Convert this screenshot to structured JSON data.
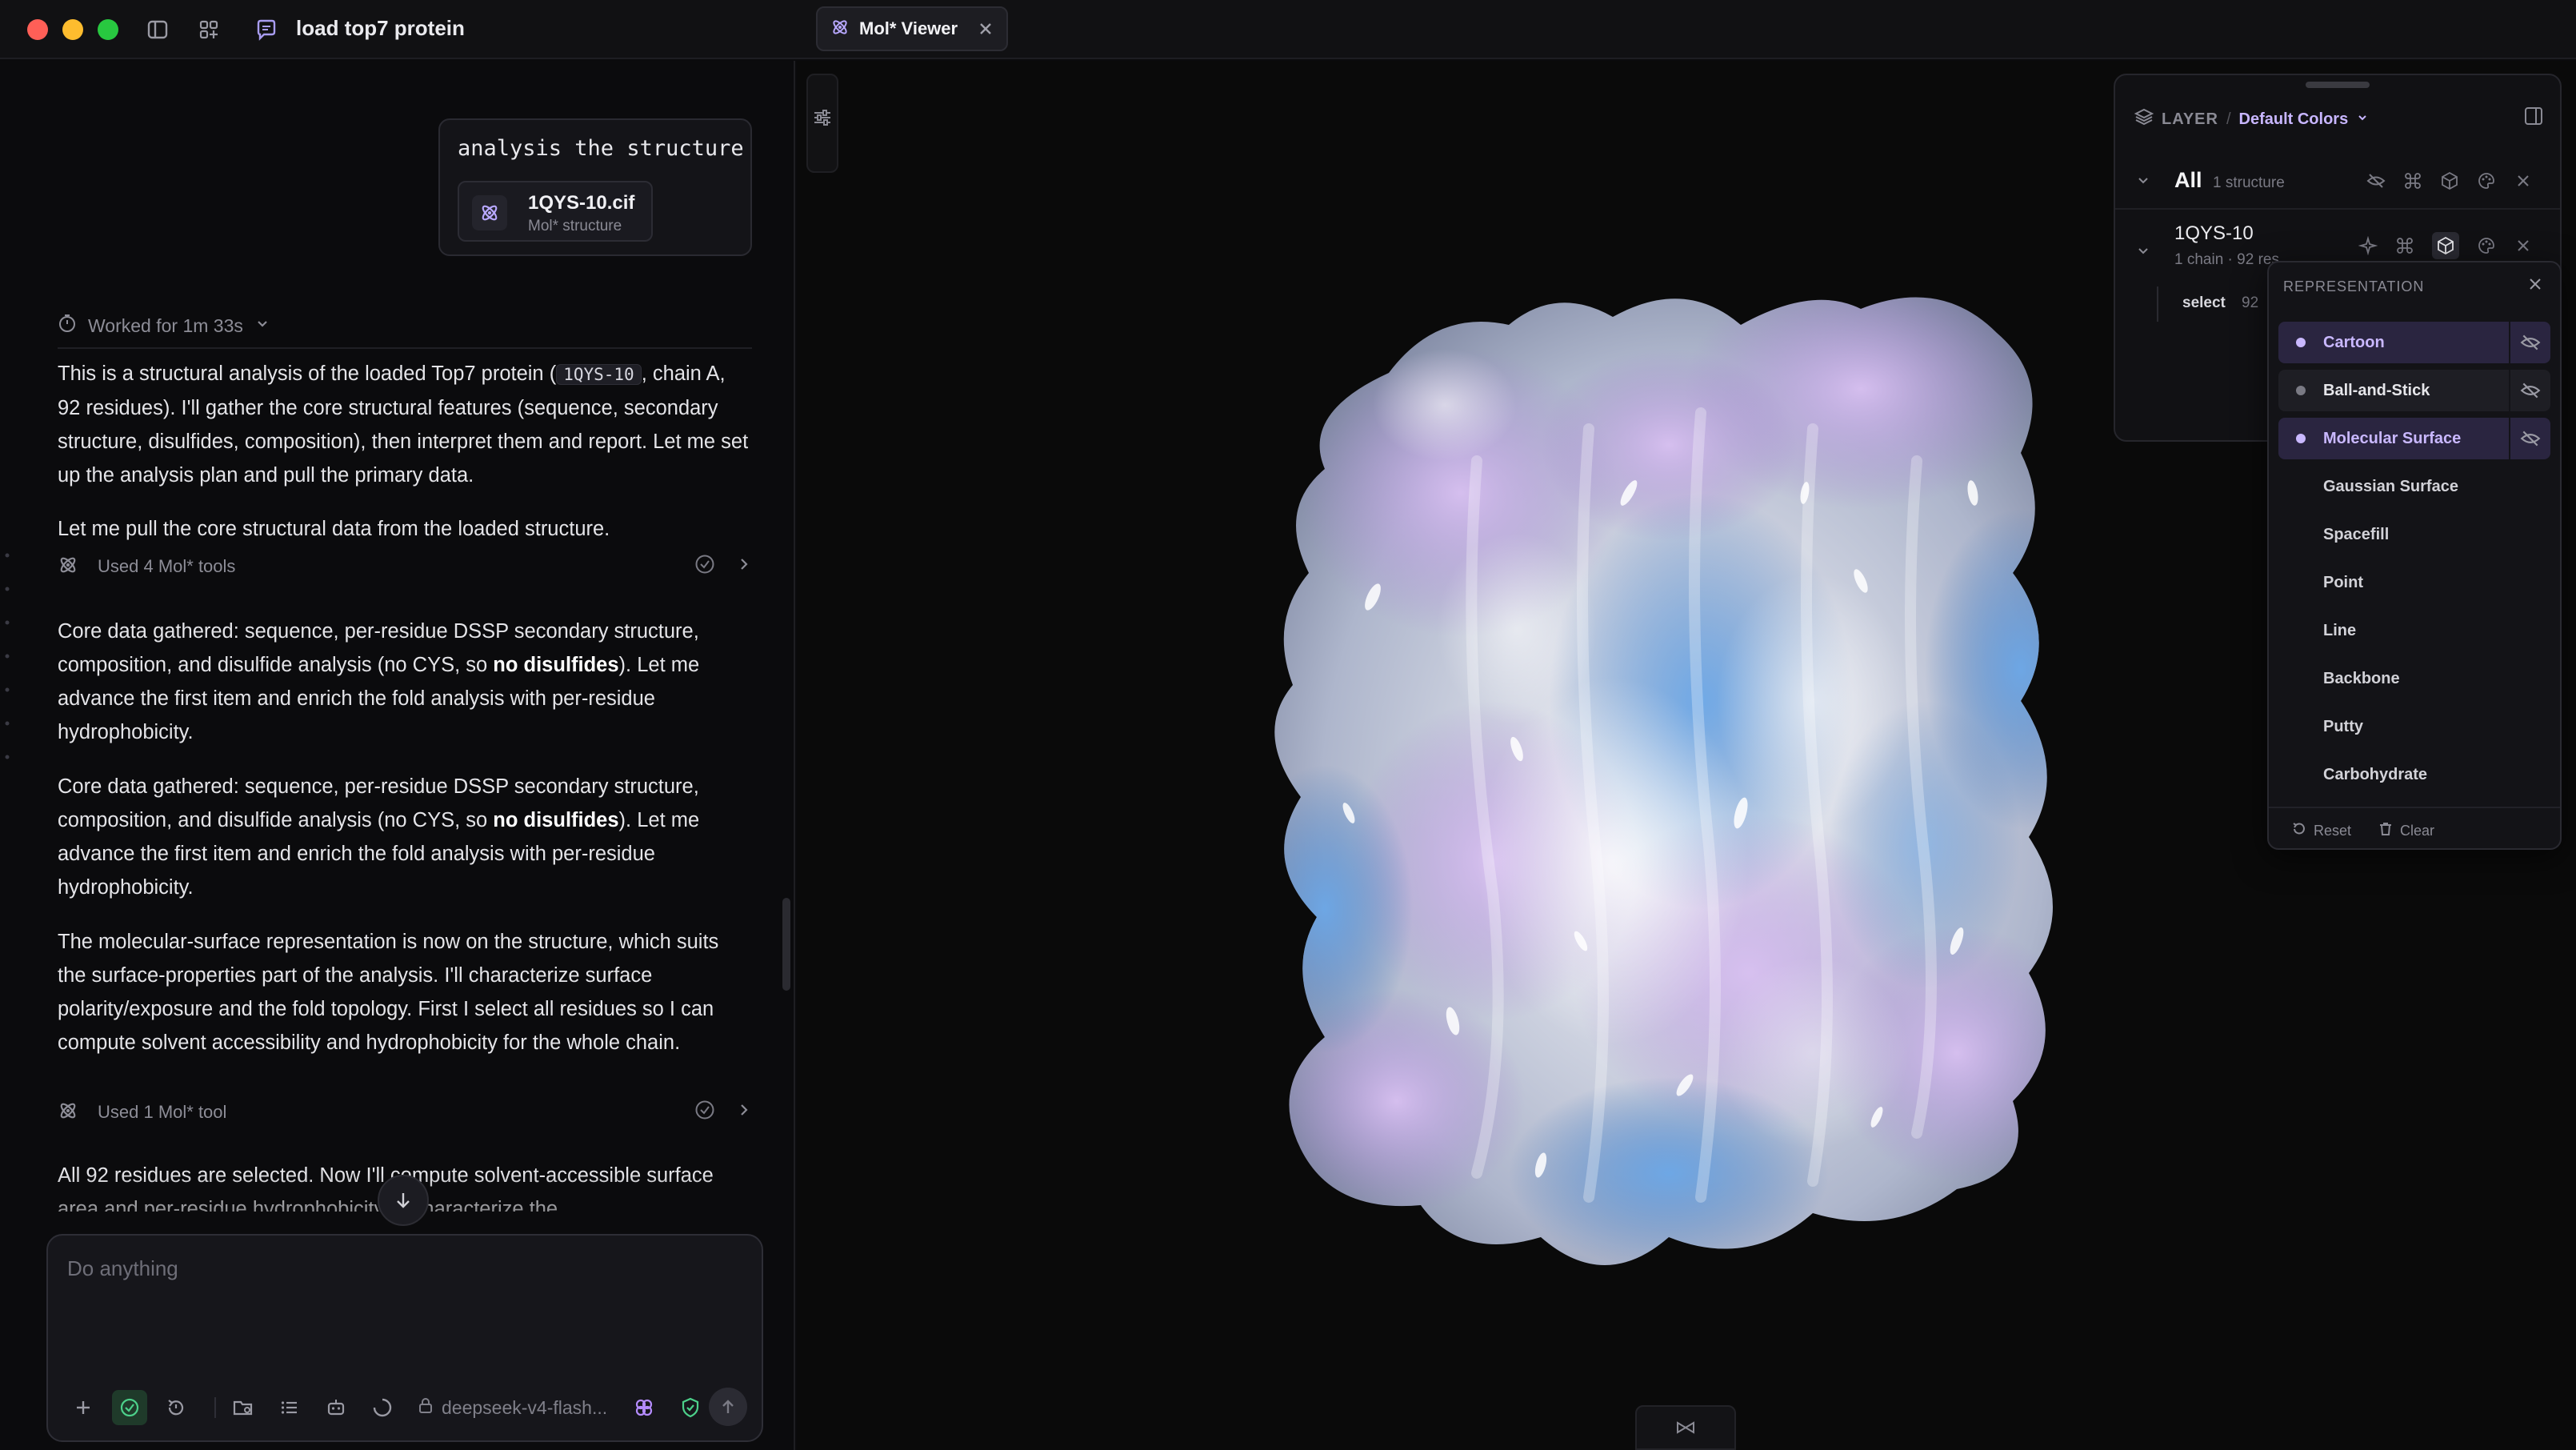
{
  "window": {
    "title": "load top7 protein",
    "tab_label": "Mol* Viewer"
  },
  "chat": {
    "user_message": "analysis the structure",
    "attachment": {
      "name": "1QYS-10.cif",
      "type": "Mol* structure"
    },
    "worked_for": "Worked for 1m 33s",
    "p1_a": "This is a structural analysis of the loaded Top7 protein (",
    "p1_code": "1QYS-10",
    "p1_b": ", chain A, 92 residues). I'll gather the core structural features (sequence, secondary structure, disulfides, composition), then interpret them and report. Let me set up the analysis plan and pull the primary data.",
    "p2": "Let me pull the core structural data from the loaded structure.",
    "tool1": "Used 4 Mol* tools",
    "p3_a": "Core data gathered: sequence, per-residue DSSP secondary structure, composition, and disulfide analysis (no CYS, so ",
    "p3_bold": "no disulfides",
    "p3_b": "). Let me advance the first item and enrich the fold analysis with per-residue hydrophobicity.",
    "p4_a": "Core data gathered: sequence, per-residue DSSP secondary structure, composition, and disulfide analysis (no CYS, so ",
    "p4_bold": "no disulfides",
    "p4_b": "). Let me advance the first item and enrich the fold analysis with per-residue hydrophobicity.",
    "p5": "The molecular-surface representation is now on the structure, which suits the surface-properties part of the analysis. I'll characterize surface polarity/exposure and the fold topology. First I select all residues so I can compute solvent accessibility and hydrophobicity for the whole chain.",
    "tool2": "Used 1 Mol* tool",
    "p6": "All 92 residues are selected. Now I'll compute solvent-accessible surface area and per-residue hydrophobicity to characterize the"
  },
  "composer": {
    "placeholder": "Do anything",
    "model": "deepseek-v4-flash..."
  },
  "layer_panel": {
    "label": "LAYER",
    "preset": "Default Colors",
    "all_label": "All",
    "all_sub": "1 structure",
    "structure_name": "1QYS-10",
    "structure_sub": "1 chain · 92 res",
    "select_label": "select",
    "select_count": "92"
  },
  "representation": {
    "header": "REPRESENTATION",
    "items": [
      {
        "label": "Cartoon",
        "state": "active"
      },
      {
        "label": "Ball-and-Stick",
        "state": "mid"
      },
      {
        "label": "Molecular Surface",
        "state": "active"
      },
      {
        "label": "Gaussian Surface",
        "state": "none"
      },
      {
        "label": "Spacefill",
        "state": "none"
      },
      {
        "label": "Point",
        "state": "none"
      },
      {
        "label": "Line",
        "state": "none"
      },
      {
        "label": "Backbone",
        "state": "none"
      },
      {
        "label": "Putty",
        "state": "none"
      },
      {
        "label": "Carbohydrate",
        "state": "none"
      }
    ],
    "reset_label": "Reset",
    "clear_label": "Clear"
  },
  "colors": {
    "accent": "#c9b8ff",
    "surface_purple": "#b99ad8",
    "surface_blue": "#4f8fd0",
    "surface_white": "#eef0f4"
  }
}
